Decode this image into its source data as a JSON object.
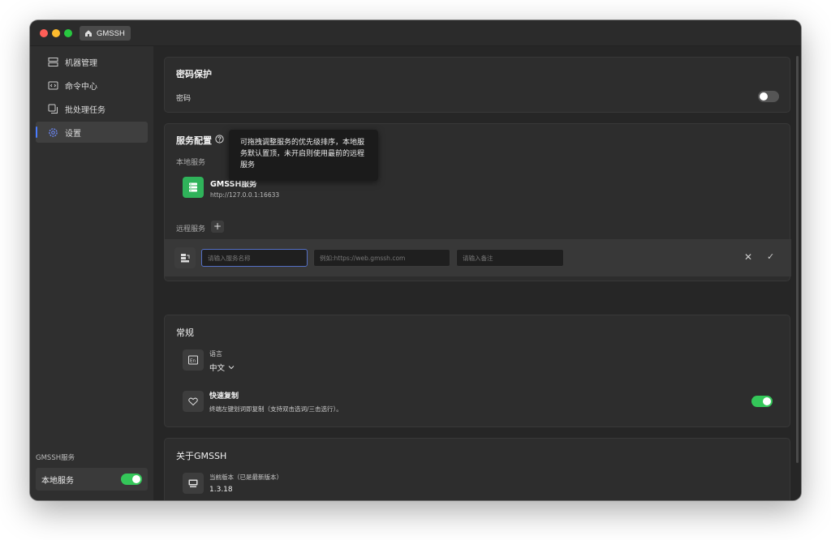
{
  "window": {
    "tab_label": "GMSSH"
  },
  "sidebar": {
    "items": [
      {
        "label": "机器管理",
        "icon": "server-icon"
      },
      {
        "label": "命令中心",
        "icon": "code-icon"
      },
      {
        "label": "批处理任务",
        "icon": "batch-icon"
      },
      {
        "label": "设置",
        "icon": "gear-icon",
        "active": true
      }
    ],
    "footer_label": "GMSSH服务",
    "local_service": {
      "label": "本地服务",
      "enabled": true
    }
  },
  "password_section": {
    "title": "密码保护",
    "password_label": "密码",
    "enabled": false
  },
  "service_section": {
    "title": "服务配置",
    "tooltip": "可拖拽调整服务的优先级排序，本地服务默认置顶，未开启则使用最前的远程服务",
    "local_label": "本地服务",
    "local_service": {
      "name": "GMSSH服务",
      "url": "http://127.0.0.1:16633"
    },
    "remote_label": "远程服务",
    "add_symbol": "+",
    "remote_form": {
      "name_placeholder": "请输入服务名称",
      "url_placeholder": "例如:https://web.gmssh.com",
      "note_placeholder": "请输入备注",
      "cancel_symbol": "✕",
      "confirm_symbol": "✓"
    }
  },
  "general_section": {
    "title": "常规",
    "language_label": "语言",
    "language_value": "中文",
    "quick_copy_title": "快速复制",
    "quick_copy_desc": "终端左键划词即复制（支持双击选词/三击选行）。",
    "quick_copy_enabled": true
  },
  "about_section": {
    "title": "关于GMSSH",
    "version_label": "当前版本（已是最新版本）",
    "version": "1.3.18"
  },
  "colors": {
    "accent": "#4a7cff",
    "toggle_on": "#34c759",
    "service_icon": "#2fb35a"
  }
}
